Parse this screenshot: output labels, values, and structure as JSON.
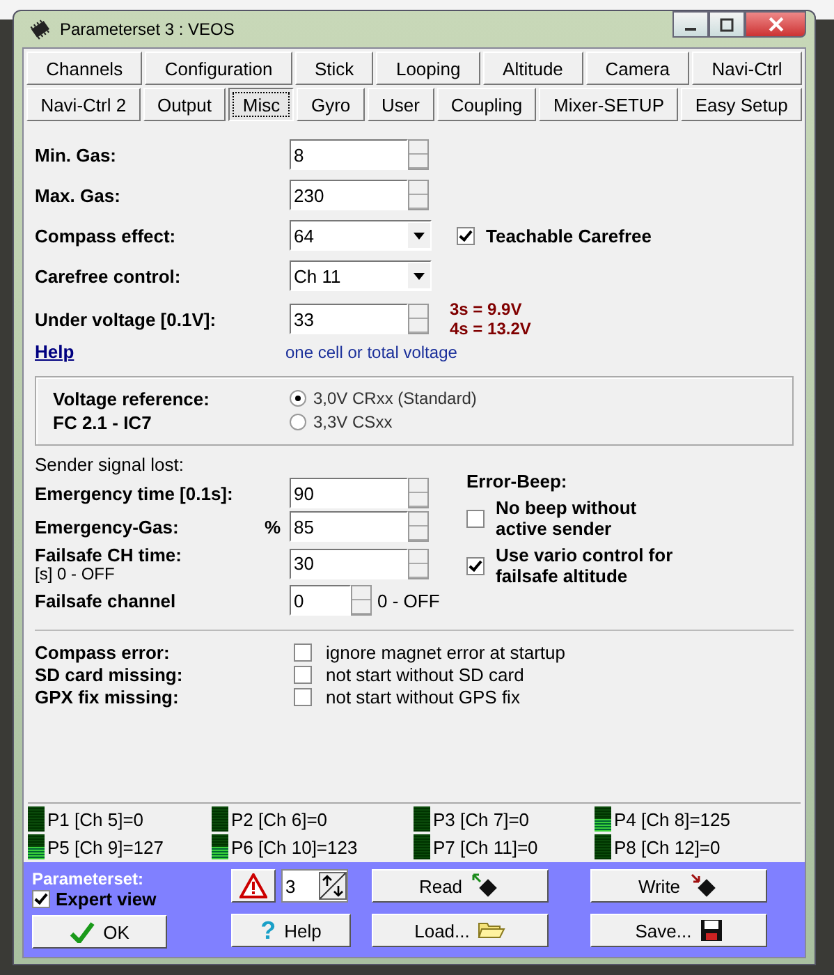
{
  "window": {
    "title": "Parameterset 3 : VEOS"
  },
  "tabs": [
    [
      {
        "label": "Channels",
        "selected": false
      },
      {
        "label": "Configuration",
        "selected": false
      },
      {
        "label": "Stick",
        "selected": false
      },
      {
        "label": "Looping",
        "selected": false
      },
      {
        "label": "Altitude",
        "selected": false
      },
      {
        "label": "Camera",
        "selected": false
      },
      {
        "label": "Navi-Ctrl",
        "selected": false
      }
    ],
    [
      {
        "label": "Navi-Ctrl 2",
        "selected": false
      },
      {
        "label": "Output",
        "selected": false
      },
      {
        "label": "Misc",
        "selected": true
      },
      {
        "label": "Gyro",
        "selected": false
      },
      {
        "label": "User",
        "selected": false
      },
      {
        "label": "Coupling",
        "selected": false
      },
      {
        "label": "Mixer-SETUP",
        "selected": false
      },
      {
        "label": "Easy Setup",
        "selected": false
      }
    ]
  ],
  "settings": [
    {
      "label": "Min. Gas:",
      "kind": "spin",
      "value": "8"
    },
    {
      "label": "Max. Gas:",
      "kind": "spin",
      "value": "230"
    },
    {
      "label": "Compass effect:",
      "kind": "combo",
      "value": "64"
    },
    {
      "label": "Carefree control:",
      "kind": "combo",
      "value": "Ch 11"
    },
    {
      "label": "Under voltage [0.1V]:",
      "kind": "spin",
      "value": "33"
    }
  ],
  "teachable_carefree": {
    "label": "Teachable Carefree",
    "checked": true
  },
  "voltage_info": [
    "3s = 9.9V",
    "4s = 13.2V"
  ],
  "help_link": "Help",
  "voltage_hint": "one cell or total voltage",
  "voltage_reference": {
    "labels": [
      "Voltage reference:",
      "FC 2.1 - IC7"
    ],
    "options": [
      {
        "label": "3,0V CRxx (Standard)",
        "selected": true
      },
      {
        "label": "3,3V CSxx",
        "selected": false
      }
    ]
  },
  "signal_lost": {
    "heading": "Sender signal lost:",
    "fields": [
      {
        "label": "Emergency time [0.1s]:",
        "value": "90"
      },
      {
        "label": "Emergency-Gas:",
        "unit": "%",
        "value": "85"
      },
      {
        "label": "Failsafe CH time:",
        "note": "[s] 0 - OFF",
        "value": "30"
      }
    ],
    "failsafe_channel": {
      "label": "Failsafe channel",
      "value": "0",
      "suffix": "0 - OFF"
    },
    "error_beep": {
      "heading": "Error-Beep:",
      "options": [
        {
          "label": "No beep without active sender",
          "checked": false
        },
        {
          "label": "Use vario control for failsafe altitude",
          "checked": true
        }
      ]
    }
  },
  "start_checks": [
    {
      "label": "Compass error:",
      "option": "ignore magnet error at startup",
      "checked": false
    },
    {
      "label": "SD card missing:",
      "option": "not start without SD card",
      "checked": false
    },
    {
      "label": "GPX fix missing:",
      "option": "not start without GPS fix",
      "checked": false
    }
  ],
  "poti_meters": [
    {
      "label": "P1 [Ch 5]=0",
      "level": 0
    },
    {
      "label": "P2 [Ch 6]=0",
      "level": 0
    },
    {
      "label": "P3 [Ch 7]=0",
      "level": 0
    },
    {
      "label": "P4 [Ch 8]=125",
      "level": 0.49
    },
    {
      "label": "P5 [Ch 9]=127",
      "level": 0.5
    },
    {
      "label": "P6 [Ch 10]=123",
      "level": 0.48
    },
    {
      "label": "P7 [Ch 11]=0",
      "level": 0
    },
    {
      "label": "P8 [Ch 12]=0",
      "level": 0
    }
  ],
  "footer": {
    "parameterset_label": "Parameterset:",
    "expert_view": {
      "label": "Expert view",
      "checked": true
    },
    "set_number": "3",
    "help_icon": "?",
    "buttons": [
      {
        "kind": "read",
        "label": "Read"
      },
      {
        "kind": "write",
        "label": "Write"
      },
      {
        "kind": "ok",
        "label": "OK"
      },
      {
        "kind": "help",
        "label": "Help"
      },
      {
        "kind": "load",
        "label": "Load..."
      },
      {
        "kind": "save",
        "label": "Save..."
      }
    ]
  }
}
